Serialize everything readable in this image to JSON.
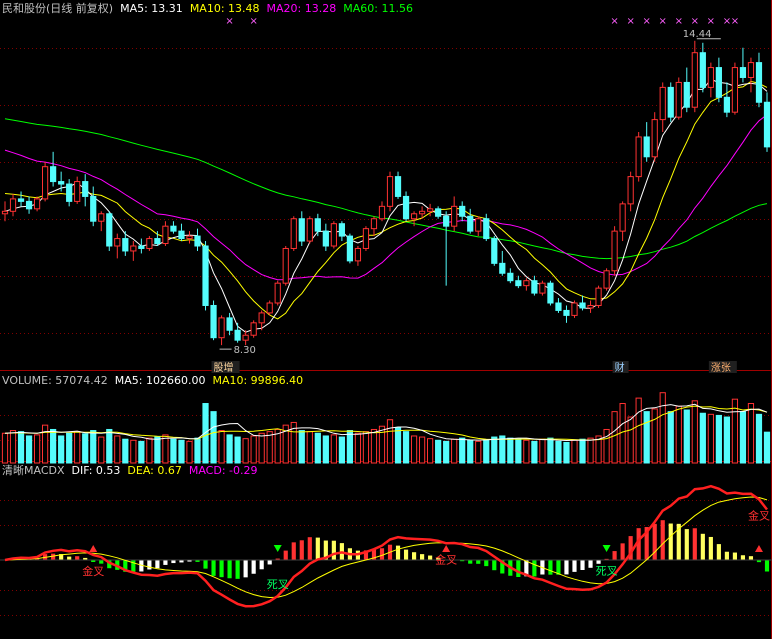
{
  "colors": {
    "up": "#ff3232",
    "down": "#54fcfc",
    "ma5": "#ffffff",
    "ma10": "#ffff00",
    "ma20": "#ff00ff",
    "ma60": "#00ff00",
    "grid": "#800000",
    "bg": "#000000"
  },
  "price_header": {
    "title": "民和股份(日线 前复权)",
    "ma5": "MA5: 13.31",
    "ma10": "MA10: 13.48",
    "ma20": "MA20: 13.28",
    "ma60": "MA60: 11.56"
  },
  "volume_header": {
    "title": "VOLUME: 57074.42",
    "ma5": "MA5: 102660.00",
    "ma10": "MA10: 99896.40"
  },
  "macd_header": {
    "title": "清晰MACDX",
    "dif": "DIF: 0.53",
    "dea": "DEA: 0.67",
    "macd": "MACD: -0.29"
  },
  "chart_data": [
    {
      "type": "candlestick",
      "panel": "price",
      "ohlc": [
        [
          10.95,
          11.2,
          10.8,
          11.0
        ],
        [
          11.0,
          11.35,
          10.9,
          11.25
        ],
        [
          11.25,
          11.4,
          11.1,
          11.2
        ],
        [
          11.2,
          11.3,
          10.95,
          11.05
        ],
        [
          11.05,
          11.3,
          11.0,
          11.25
        ],
        [
          11.25,
          12.0,
          11.2,
          11.9
        ],
        [
          11.9,
          12.2,
          11.5,
          11.6
        ],
        [
          11.6,
          11.8,
          11.4,
          11.55
        ],
        [
          11.55,
          11.65,
          11.1,
          11.2
        ],
        [
          11.2,
          11.7,
          11.15,
          11.6
        ],
        [
          11.6,
          11.75,
          11.1,
          11.3
        ],
        [
          11.3,
          11.5,
          10.7,
          10.8
        ],
        [
          10.8,
          11.0,
          10.6,
          10.95
        ],
        [
          10.95,
          11.0,
          10.2,
          10.3
        ],
        [
          10.3,
          10.55,
          10.05,
          10.45
        ],
        [
          10.45,
          10.6,
          10.1,
          10.2
        ],
        [
          10.2,
          10.4,
          10.0,
          10.3
        ],
        [
          10.3,
          10.45,
          10.15,
          10.25
        ],
        [
          10.25,
          10.5,
          10.2,
          10.45
        ],
        [
          10.45,
          10.6,
          10.3,
          10.35
        ],
        [
          10.35,
          10.8,
          10.3,
          10.7
        ],
        [
          10.7,
          10.8,
          10.55,
          10.6
        ],
        [
          10.6,
          10.75,
          10.4,
          10.45
        ],
        [
          10.45,
          10.6,
          10.35,
          10.5
        ],
        [
          10.5,
          10.65,
          10.2,
          10.3
        ],
        [
          10.3,
          10.4,
          9.0,
          9.1
        ],
        [
          9.1,
          9.2,
          8.4,
          8.45
        ],
        [
          8.45,
          8.9,
          8.3,
          8.85
        ],
        [
          8.85,
          8.95,
          8.5,
          8.6
        ],
        [
          8.6,
          8.75,
          8.35,
          8.4
        ],
        [
          8.4,
          8.6,
          8.3,
          8.5
        ],
        [
          8.5,
          8.8,
          8.45,
          8.75
        ],
        [
          8.75,
          9.0,
          8.6,
          8.95
        ],
        [
          8.95,
          9.2,
          8.9,
          9.15
        ],
        [
          9.15,
          9.6,
          9.1,
          9.55
        ],
        [
          9.55,
          10.3,
          9.5,
          10.25
        ],
        [
          10.25,
          10.9,
          10.2,
          10.85
        ],
        [
          10.85,
          11.0,
          10.3,
          10.4
        ],
        [
          10.4,
          10.9,
          10.35,
          10.85
        ],
        [
          10.85,
          10.95,
          10.5,
          10.6
        ],
        [
          10.6,
          10.75,
          10.2,
          10.3
        ],
        [
          10.3,
          10.8,
          10.25,
          10.75
        ],
        [
          10.75,
          10.8,
          10.4,
          10.5
        ],
        [
          10.5,
          10.55,
          9.95,
          10.0
        ],
        [
          10.0,
          10.3,
          9.9,
          10.25
        ],
        [
          10.25,
          10.7,
          10.2,
          10.65
        ],
        [
          10.65,
          10.9,
          10.5,
          10.85
        ],
        [
          10.85,
          11.2,
          10.8,
          11.1
        ],
        [
          11.1,
          11.8,
          11.0,
          11.7
        ],
        [
          11.7,
          11.8,
          11.25,
          11.3
        ],
        [
          11.3,
          11.4,
          10.8,
          10.85
        ],
        [
          10.85,
          11.0,
          10.7,
          10.95
        ],
        [
          10.95,
          11.1,
          10.85,
          11.0
        ],
        [
          11.0,
          11.15,
          10.9,
          11.05
        ],
        [
          11.05,
          11.1,
          10.85,
          10.9
        ],
        [
          10.9,
          11.0,
          9.5,
          10.7
        ],
        [
          10.7,
          11.3,
          10.6,
          11.1
        ],
        [
          11.1,
          11.2,
          10.8,
          10.9
        ],
        [
          10.9,
          11.05,
          10.55,
          10.6
        ],
        [
          10.6,
          10.9,
          10.5,
          10.85
        ],
        [
          10.85,
          10.95,
          10.4,
          10.45
        ],
        [
          10.45,
          10.5,
          9.9,
          9.95
        ],
        [
          9.95,
          10.2,
          9.7,
          9.75
        ],
        [
          9.75,
          9.85,
          9.55,
          9.6
        ],
        [
          9.6,
          9.7,
          9.45,
          9.5
        ],
        [
          9.5,
          9.65,
          9.4,
          9.6
        ],
        [
          9.6,
          9.7,
          9.3,
          9.35
        ],
        [
          9.35,
          9.6,
          9.3,
          9.55
        ],
        [
          9.55,
          9.6,
          9.1,
          9.15
        ],
        [
          9.15,
          9.25,
          8.95,
          9.0
        ],
        [
          9.0,
          9.1,
          8.75,
          8.9
        ],
        [
          8.9,
          9.2,
          8.85,
          9.15
        ],
        [
          9.15,
          9.3,
          9.0,
          9.05
        ],
        [
          9.05,
          9.2,
          8.95,
          9.1
        ],
        [
          9.1,
          9.5,
          9.05,
          9.45
        ],
        [
          9.45,
          9.85,
          9.4,
          9.8
        ],
        [
          9.8,
          10.7,
          9.7,
          10.6
        ],
        [
          10.6,
          11.2,
          10.4,
          11.15
        ],
        [
          11.15,
          11.8,
          11.0,
          11.7
        ],
        [
          11.7,
          12.6,
          11.6,
          12.5
        ],
        [
          12.5,
          12.8,
          12.0,
          12.1
        ],
        [
          12.1,
          13.0,
          12.0,
          12.85
        ],
        [
          12.85,
          13.6,
          12.6,
          13.5
        ],
        [
          13.5,
          13.6,
          12.8,
          12.9
        ],
        [
          12.9,
          13.7,
          12.85,
          13.6
        ],
        [
          13.6,
          13.9,
          13.0,
          13.1
        ],
        [
          13.1,
          14.44,
          13.0,
          14.2
        ],
        [
          14.2,
          14.4,
          13.4,
          13.5
        ],
        [
          13.5,
          14.0,
          13.3,
          13.9
        ],
        [
          13.9,
          14.1,
          13.2,
          13.3
        ],
        [
          13.3,
          13.6,
          12.9,
          13.0
        ],
        [
          13.0,
          14.0,
          12.95,
          13.9
        ],
        [
          13.9,
          14.3,
          13.6,
          13.7
        ],
        [
          13.7,
          14.1,
          13.4,
          14.0
        ],
        [
          14.0,
          14.2,
          13.1,
          13.2
        ],
        [
          13.2,
          13.4,
          12.2,
          12.3
        ]
      ],
      "ylim": [
        8.0,
        14.9
      ],
      "ma_lines": [
        "MA5",
        "MA10",
        "MA20",
        "MA60"
      ],
      "annotations": [
        {
          "text": "8.30",
          "type": "low"
        },
        {
          "text": "14.44",
          "type": "high"
        }
      ],
      "event_tags": [
        {
          "text": "股增"
        },
        {
          "text": "财"
        },
        {
          "text": "涨张"
        }
      ],
      "marker_symbol": "×"
    },
    {
      "type": "bar",
      "panel": "volume",
      "volume": [
        55,
        60,
        58,
        50,
        52,
        70,
        62,
        50,
        55,
        58,
        54,
        60,
        48,
        62,
        50,
        44,
        42,
        40,
        46,
        48,
        52,
        44,
        42,
        40,
        46,
        110,
        95,
        60,
        52,
        48,
        45,
        50,
        55,
        58,
        62,
        70,
        75,
        60,
        58,
        55,
        50,
        52,
        48,
        60,
        55,
        58,
        62,
        68,
        80,
        65,
        58,
        50,
        48,
        45,
        42,
        40,
        44,
        46,
        42,
        40,
        42,
        48,
        50,
        46,
        44,
        42,
        40,
        44,
        46,
        40,
        38,
        42,
        44,
        46,
        50,
        62,
        95,
        110,
        85,
        120,
        95,
        100,
        130,
        95,
        105,
        98,
        115,
        92,
        90,
        88,
        85,
        118,
        95,
        110,
        90,
        57
      ],
      "ylim": [
        0,
        135
      ]
    },
    {
      "type": "bar",
      "panel": "macd",
      "labels": [
        "金叉",
        "死叉",
        "金叉",
        "死叉",
        "金叉",
        "死叉",
        "金叉",
        "死叉"
      ],
      "ylim": [
        -0.9,
        1.0
      ]
    }
  ]
}
